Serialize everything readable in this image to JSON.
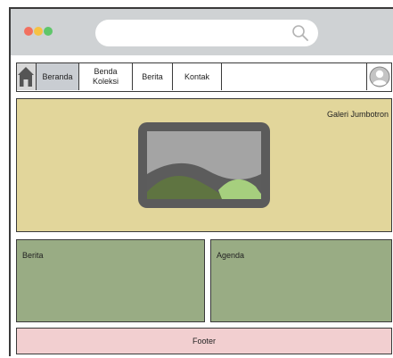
{
  "nav": {
    "items": [
      {
        "label": "Beranda",
        "active": true
      },
      {
        "label": "Benda\nKoleksi",
        "active": false
      },
      {
        "label": "Berita",
        "active": false
      },
      {
        "label": "Kontak",
        "active": false
      }
    ]
  },
  "jumbotron": {
    "label": "Galeri Jumbotron"
  },
  "panels": {
    "left_label": "Berita",
    "right_label": "Agenda"
  },
  "footer": {
    "label": "Footer"
  },
  "colors": {
    "titlebar": "#cfd2d4",
    "jumbotron": "#e2d69b",
    "panels": "#99ac84",
    "footer": "#f2cfd0",
    "active_tab": "#c9cdd2"
  },
  "icons": [
    "home-icon",
    "search-icon",
    "user-avatar-icon",
    "image-placeholder-icon"
  ]
}
